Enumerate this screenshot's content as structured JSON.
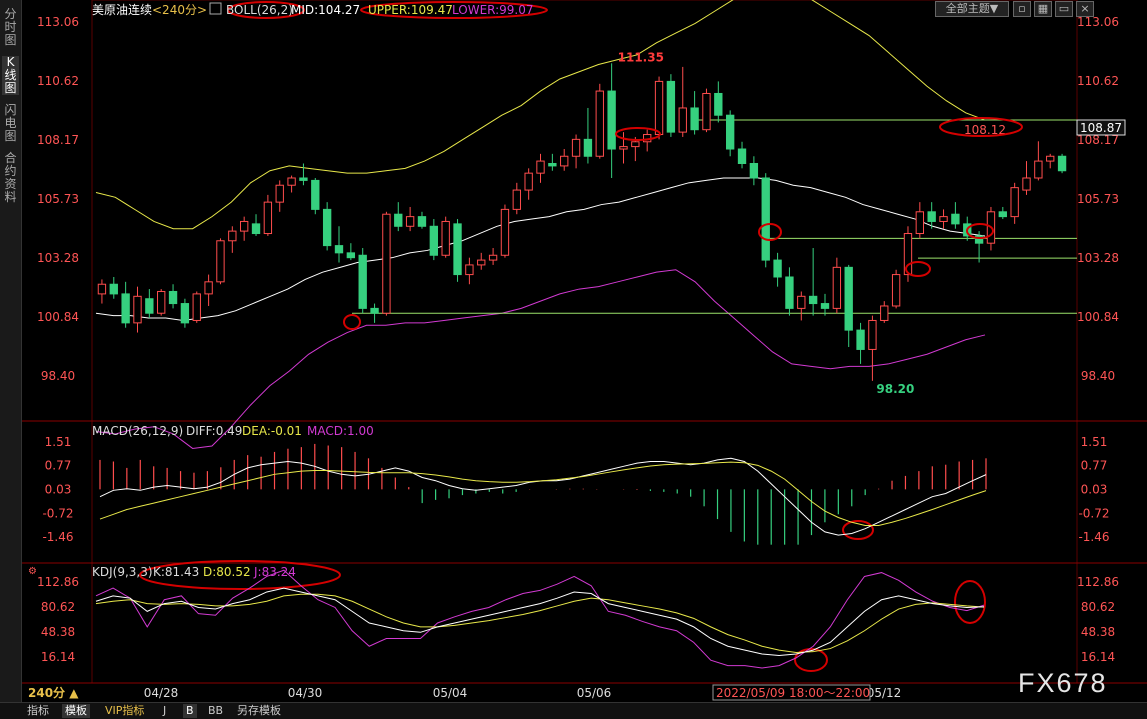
{
  "sidebar": {
    "tabs": [
      {
        "label": "分时图",
        "active": false
      },
      {
        "label": "K线图",
        "active": true
      },
      {
        "label": "闪电图",
        "active": false
      },
      {
        "label": "合约资料",
        "active": false
      }
    ]
  },
  "header": {
    "symbol": "美原油连续",
    "period": "<240分>",
    "boll_name": "BOLL(26,2)",
    "mid": "MID:104.27",
    "upper": "UPPER:109.47",
    "lower": "LOWER:99.07",
    "theme_button": "全部主题▼"
  },
  "main": {
    "y_ticks": [
      "113.06",
      "110.62",
      "108.17",
      "105.73",
      "103.28",
      "100.84",
      "98.40"
    ],
    "high_label": "111.35",
    "low_label": "98.20",
    "last_high_label": "108.12",
    "price_tag": "108.87"
  },
  "macd": {
    "title": "MACD(26,12,9)",
    "diff": "DIFF:0.49",
    "dea": "DEA:-0.01",
    "macd": "MACD:1.00",
    "ticks": [
      "1.51",
      "0.77",
      "0.03",
      "-0.72",
      "-1.46"
    ]
  },
  "kdj": {
    "title": "KDJ(9,3,3)",
    "k": "K:81.43",
    "d": "D:80.52",
    "j": "J:83.24",
    "ticks": [
      "112.86",
      "80.62",
      "48.38",
      "16.14"
    ]
  },
  "x_axis": {
    "period_badge": "240分 ▲",
    "dates": [
      "04/28",
      "04/30",
      "05/04",
      "05/06",
      "05/12"
    ],
    "cursor_label": "2022/05/09 18:00～22:00"
  },
  "bottom_bar": {
    "items": [
      {
        "label": "指标",
        "active": false
      },
      {
        "label": "模板",
        "active": true
      },
      {
        "label": "VIP指标",
        "active": false
      },
      {
        "label": "J",
        "active": false
      },
      {
        "label": "B",
        "active": false
      },
      {
        "label": "BB",
        "active": false
      },
      {
        "label": "另存模板",
        "active": false
      }
    ]
  },
  "watermark": "FX678",
  "colors": {
    "up": "#ff4d4d",
    "down": "#36d07f",
    "boll_mid": "#ffffff",
    "boll_upper": "#e8e84a",
    "boll_lower": "#d23ad2",
    "annotation": "#d40000",
    "hline": "#9be36b",
    "axis_text": "#ff5555"
  },
  "chart_data": {
    "type": "candlestick",
    "price_axis": [
      98.4,
      113.06
    ],
    "candles": [
      {
        "o": 101.8,
        "h": 102.4,
        "l": 101.4,
        "c": 102.2
      },
      {
        "o": 102.2,
        "h": 102.5,
        "l": 101.6,
        "c": 101.8
      },
      {
        "o": 101.8,
        "h": 102.3,
        "l": 100.4,
        "c": 100.6
      },
      {
        "o": 100.6,
        "h": 102.1,
        "l": 100.2,
        "c": 101.7
      },
      {
        "o": 101.6,
        "h": 102.0,
        "l": 100.8,
        "c": 101.0
      },
      {
        "o": 101.0,
        "h": 102.0,
        "l": 100.9,
        "c": 101.9
      },
      {
        "o": 101.9,
        "h": 102.2,
        "l": 101.2,
        "c": 101.4
      },
      {
        "o": 101.4,
        "h": 101.6,
        "l": 100.4,
        "c": 100.6
      },
      {
        "o": 100.7,
        "h": 101.9,
        "l": 100.6,
        "c": 101.8
      },
      {
        "o": 101.8,
        "h": 102.6,
        "l": 101.3,
        "c": 102.3
      },
      {
        "o": 102.3,
        "h": 104.1,
        "l": 102.2,
        "c": 104.0
      },
      {
        "o": 104.0,
        "h": 104.6,
        "l": 103.5,
        "c": 104.4
      },
      {
        "o": 104.4,
        "h": 105.0,
        "l": 104.0,
        "c": 104.8
      },
      {
        "o": 104.7,
        "h": 105.1,
        "l": 104.2,
        "c": 104.3
      },
      {
        "o": 104.3,
        "h": 105.9,
        "l": 104.2,
        "c": 105.6
      },
      {
        "o": 105.6,
        "h": 106.5,
        "l": 105.2,
        "c": 106.3
      },
      {
        "o": 106.3,
        "h": 106.7,
        "l": 106.0,
        "c": 106.6
      },
      {
        "o": 106.6,
        "h": 107.2,
        "l": 106.3,
        "c": 106.5
      },
      {
        "o": 106.5,
        "h": 106.6,
        "l": 105.1,
        "c": 105.3
      },
      {
        "o": 105.3,
        "h": 105.6,
        "l": 103.6,
        "c": 103.8
      },
      {
        "o": 103.8,
        "h": 104.6,
        "l": 103.1,
        "c": 103.5
      },
      {
        "o": 103.5,
        "h": 103.9,
        "l": 103.2,
        "c": 103.3
      },
      {
        "o": 103.4,
        "h": 103.7,
        "l": 101.0,
        "c": 101.2
      },
      {
        "o": 101.2,
        "h": 101.4,
        "l": 100.6,
        "c": 101.0
      },
      {
        "o": 101.0,
        "h": 105.2,
        "l": 100.9,
        "c": 105.1
      },
      {
        "o": 105.1,
        "h": 105.6,
        "l": 104.4,
        "c": 104.6
      },
      {
        "o": 104.6,
        "h": 105.4,
        "l": 104.4,
        "c": 105.0
      },
      {
        "o": 105.0,
        "h": 105.2,
        "l": 104.5,
        "c": 104.6
      },
      {
        "o": 104.6,
        "h": 104.9,
        "l": 103.2,
        "c": 103.4
      },
      {
        "o": 103.4,
        "h": 105.0,
        "l": 103.3,
        "c": 104.8
      },
      {
        "o": 104.7,
        "h": 104.9,
        "l": 102.3,
        "c": 102.6
      },
      {
        "o": 102.6,
        "h": 103.3,
        "l": 102.2,
        "c": 103.0
      },
      {
        "o": 103.0,
        "h": 103.5,
        "l": 102.8,
        "c": 103.2
      },
      {
        "o": 103.2,
        "h": 103.7,
        "l": 103.0,
        "c": 103.4
      },
      {
        "o": 103.4,
        "h": 105.5,
        "l": 103.3,
        "c": 105.3
      },
      {
        "o": 105.3,
        "h": 106.4,
        "l": 105.1,
        "c": 106.1
      },
      {
        "o": 106.1,
        "h": 107.0,
        "l": 105.7,
        "c": 106.8
      },
      {
        "o": 106.8,
        "h": 107.6,
        "l": 106.4,
        "c": 107.3
      },
      {
        "o": 107.2,
        "h": 107.6,
        "l": 106.9,
        "c": 107.1
      },
      {
        "o": 107.1,
        "h": 107.8,
        "l": 106.9,
        "c": 107.5
      },
      {
        "o": 107.5,
        "h": 108.4,
        "l": 107.0,
        "c": 108.2
      },
      {
        "o": 108.2,
        "h": 109.5,
        "l": 107.2,
        "c": 107.5
      },
      {
        "o": 107.5,
        "h": 110.5,
        "l": 107.4,
        "c": 110.2
      },
      {
        "o": 110.2,
        "h": 111.35,
        "l": 106.6,
        "c": 107.8
      },
      {
        "o": 107.8,
        "h": 108.5,
        "l": 107.2,
        "c": 107.9
      },
      {
        "o": 107.9,
        "h": 108.3,
        "l": 107.3,
        "c": 108.1
      },
      {
        "o": 108.1,
        "h": 108.6,
        "l": 107.7,
        "c": 108.4
      },
      {
        "o": 108.4,
        "h": 110.8,
        "l": 108.2,
        "c": 110.6
      },
      {
        "o": 110.6,
        "h": 110.9,
        "l": 108.3,
        "c": 108.5
      },
      {
        "o": 108.5,
        "h": 111.2,
        "l": 108.3,
        "c": 109.5
      },
      {
        "o": 109.5,
        "h": 110.2,
        "l": 108.4,
        "c": 108.6
      },
      {
        "o": 108.6,
        "h": 110.3,
        "l": 108.5,
        "c": 110.1
      },
      {
        "o": 110.1,
        "h": 110.6,
        "l": 108.9,
        "c": 109.2
      },
      {
        "o": 109.2,
        "h": 109.4,
        "l": 107.5,
        "c": 107.8
      },
      {
        "o": 107.8,
        "h": 108.1,
        "l": 107.0,
        "c": 107.2
      },
      {
        "o": 107.2,
        "h": 107.5,
        "l": 106.3,
        "c": 106.6
      },
      {
        "o": 106.6,
        "h": 106.8,
        "l": 102.9,
        "c": 103.2
      },
      {
        "o": 103.2,
        "h": 103.5,
        "l": 102.1,
        "c": 102.5
      },
      {
        "o": 102.5,
        "h": 102.9,
        "l": 100.9,
        "c": 101.2
      },
      {
        "o": 101.2,
        "h": 101.9,
        "l": 100.7,
        "c": 101.7
      },
      {
        "o": 101.7,
        "h": 103.7,
        "l": 100.9,
        "c": 101.4
      },
      {
        "o": 101.4,
        "h": 101.8,
        "l": 100.9,
        "c": 101.2
      },
      {
        "o": 101.2,
        "h": 103.3,
        "l": 101.0,
        "c": 102.9
      },
      {
        "o": 102.9,
        "h": 103.0,
        "l": 99.6,
        "c": 100.3
      },
      {
        "o": 100.3,
        "h": 100.6,
        "l": 98.9,
        "c": 99.5
      },
      {
        "o": 99.5,
        "h": 100.9,
        "l": 98.2,
        "c": 100.7
      },
      {
        "o": 100.7,
        "h": 101.5,
        "l": 100.6,
        "c": 101.3
      },
      {
        "o": 101.3,
        "h": 102.8,
        "l": 101.2,
        "c": 102.6
      },
      {
        "o": 102.6,
        "h": 104.6,
        "l": 102.3,
        "c": 104.3
      },
      {
        "o": 104.3,
        "h": 105.6,
        "l": 104.1,
        "c": 105.2
      },
      {
        "o": 105.2,
        "h": 105.6,
        "l": 104.5,
        "c": 104.8
      },
      {
        "o": 104.8,
        "h": 105.3,
        "l": 104.5,
        "c": 105.0
      },
      {
        "o": 105.1,
        "h": 105.6,
        "l": 104.5,
        "c": 104.7
      },
      {
        "o": 104.7,
        "h": 105.0,
        "l": 104.0,
        "c": 104.2
      },
      {
        "o": 104.2,
        "h": 104.4,
        "l": 103.1,
        "c": 103.9
      },
      {
        "o": 103.9,
        "h": 105.4,
        "l": 103.6,
        "c": 105.2
      },
      {
        "o": 105.2,
        "h": 105.4,
        "l": 104.9,
        "c": 105.0
      },
      {
        "o": 105.0,
        "h": 106.4,
        "l": 104.7,
        "c": 106.2
      },
      {
        "o": 106.1,
        "h": 107.3,
        "l": 105.9,
        "c": 106.6
      },
      {
        "o": 106.6,
        "h": 108.12,
        "l": 106.5,
        "c": 107.3
      },
      {
        "o": 107.3,
        "h": 107.6,
        "l": 107.0,
        "c": 107.5
      },
      {
        "o": 107.5,
        "h": 107.6,
        "l": 106.8,
        "c": 106.9
      }
    ],
    "boll_mid": [
      101.0,
      100.9,
      100.9,
      100.8,
      100.8,
      100.7,
      100.8,
      100.9,
      101.1,
      101.4,
      101.7,
      102.0,
      102.4,
      102.7,
      102.9,
      103.1,
      103.2,
      103.3,
      103.5,
      103.6,
      103.8,
      104.0,
      104.3,
      104.6,
      104.8,
      104.9,
      105.0,
      105.2,
      105.3,
      105.5,
      105.6,
      105.8,
      106.0,
      106.2,
      106.4,
      106.5,
      106.6,
      106.6,
      106.6,
      106.5,
      106.3,
      106.2,
      106.0,
      105.8,
      105.5,
      105.3,
      105.1,
      104.9,
      104.6,
      104.4,
      104.3,
      104.2
    ],
    "boll_upper": [
      106.0,
      105.8,
      105.3,
      104.8,
      104.5,
      104.5,
      105.0,
      105.6,
      106.4,
      106.9,
      107.1,
      107.0,
      106.9,
      106.8,
      106.8,
      106.9,
      107.0,
      107.3,
      107.7,
      108.2,
      108.7,
      109.2,
      109.6,
      110.2,
      110.7,
      111.0,
      111.3,
      111.5,
      111.7,
      112.2,
      112.6,
      113.0,
      113.5,
      114.0,
      114.3,
      114.4,
      114.3,
      114.0,
      113.5,
      113.0,
      112.5,
      111.8,
      111.1,
      110.4,
      109.8,
      109.3,
      109.0
    ],
    "boll_lower": [
      96.1,
      96.0,
      96.2,
      96.3,
      96.0,
      95.4,
      95.5,
      96.3,
      97.2,
      98.0,
      98.6,
      99.3,
      99.8,
      100.2,
      100.5,
      100.5,
      100.6,
      100.6,
      100.7,
      100.8,
      100.9,
      101.0,
      101.2,
      101.5,
      101.8,
      102.0,
      102.1,
      102.3,
      102.5,
      102.7,
      102.8,
      102.3,
      101.5,
      100.8,
      100.1,
      99.4,
      98.9,
      98.8,
      98.7,
      98.8,
      98.8,
      98.9,
      99.1,
      99.3,
      99.6,
      99.9,
      100.1
    ],
    "hlines": [
      109.0,
      103.28,
      104.1,
      101.0
    ],
    "macd_axis": [
      -1.46,
      1.51
    ],
    "macd_hist": [
      0.95,
      0.9,
      0.7,
      0.95,
      0.75,
      0.7,
      0.6,
      0.55,
      0.6,
      0.72,
      0.95,
      1.1,
      1.05,
      1.2,
      1.3,
      1.35,
      1.45,
      1.4,
      1.35,
      1.2,
      1.0,
      0.7,
      0.4,
      0.1,
      -0.4,
      -0.3,
      -0.25,
      -0.15,
      -0.1,
      -0.05,
      -0.1,
      -0.05,
      0.02,
      0.03,
      0.04,
      0.05,
      0.05,
      0.04,
      0.03,
      0.02,
      0.01,
      -0.02,
      -0.05,
      -0.1,
      -0.2,
      -0.5,
      -0.9,
      -1.3,
      -1.6,
      -1.7,
      -1.7,
      -1.7,
      -1.7,
      -1.4,
      -1.0,
      -0.75,
      -0.5,
      -0.15,
      0.05,
      0.3,
      0.45,
      0.6,
      0.75,
      0.8,
      0.9,
      0.95,
      1.0
    ],
    "macd_diff": [
      -0.2,
      0.0,
      0.05,
      0.0,
      0.1,
      0.15,
      0.1,
      0.05,
      0.1,
      0.25,
      0.5,
      0.7,
      0.8,
      0.85,
      0.9,
      0.85,
      0.75,
      0.6,
      0.5,
      0.45,
      0.5,
      0.6,
      0.7,
      0.6,
      0.4,
      0.3,
      0.15,
      0.05,
      0.0,
      0.05,
      0.1,
      0.15,
      0.25,
      0.3,
      0.3,
      0.35,
      0.45,
      0.55,
      0.65,
      0.75,
      0.85,
      0.9,
      0.9,
      0.85,
      0.8,
      0.85,
      0.95,
      1.0,
      0.9,
      0.6,
      0.2,
      -0.2,
      -0.6,
      -1.0,
      -1.3,
      -1.4,
      -1.35,
      -1.2,
      -1.0,
      -0.8,
      -0.6,
      -0.4,
      -0.2,
      -0.1,
      0.1,
      0.3,
      0.49
    ],
    "macd_dea": [
      -0.9,
      -0.75,
      -0.6,
      -0.5,
      -0.4,
      -0.3,
      -0.2,
      -0.1,
      0.0,
      0.1,
      0.2,
      0.3,
      0.4,
      0.5,
      0.55,
      0.6,
      0.62,
      0.62,
      0.6,
      0.58,
      0.56,
      0.55,
      0.55,
      0.55,
      0.52,
      0.48,
      0.42,
      0.35,
      0.3,
      0.27,
      0.25,
      0.25,
      0.27,
      0.3,
      0.33,
      0.38,
      0.43,
      0.5,
      0.57,
      0.64,
      0.7,
      0.76,
      0.8,
      0.82,
      0.83,
      0.84,
      0.86,
      0.88,
      0.86,
      0.78,
      0.6,
      0.35,
      0.0,
      -0.35,
      -0.65,
      -0.85,
      -1.0,
      -1.1,
      -1.1,
      -1.0,
      -0.88,
      -0.74,
      -0.6,
      -0.45,
      -0.3,
      -0.15,
      -0.01
    ],
    "kdj_axis": [
      0,
      125
    ],
    "kdj_k": [
      88,
      95,
      92,
      75,
      85,
      88,
      80,
      78,
      85,
      90,
      100,
      105,
      100,
      95,
      90,
      75,
      60,
      55,
      50,
      48,
      55,
      60,
      65,
      70,
      75,
      80,
      85,
      92,
      100,
      98,
      85,
      80,
      75,
      70,
      65,
      55,
      40,
      30,
      25,
      20,
      18,
      20,
      25,
      35,
      55,
      75,
      90,
      95,
      90,
      85,
      82,
      80,
      81
    ],
    "kdj_d": [
      85,
      88,
      90,
      85,
      84,
      85,
      84,
      82,
      82,
      84,
      88,
      95,
      97,
      97,
      95,
      88,
      78,
      68,
      60,
      55,
      55,
      57,
      60,
      63,
      67,
      71,
      76,
      82,
      88,
      92,
      90,
      86,
      82,
      78,
      73,
      66,
      55,
      45,
      38,
      30,
      25,
      22,
      23,
      27,
      37,
      50,
      65,
      78,
      84,
      86,
      84,
      82,
      80.5
    ],
    "kdj_j": [
      95,
      105,
      92,
      55,
      90,
      95,
      72,
      70,
      92,
      105,
      120,
      128,
      108,
      90,
      80,
      50,
      30,
      40,
      40,
      40,
      60,
      68,
      75,
      80,
      90,
      98,
      102,
      110,
      120,
      108,
      75,
      70,
      62,
      55,
      50,
      35,
      12,
      5,
      5,
      2,
      5,
      15,
      30,
      55,
      90,
      120,
      125,
      115,
      100,
      88,
      80,
      76,
      83
    ]
  }
}
